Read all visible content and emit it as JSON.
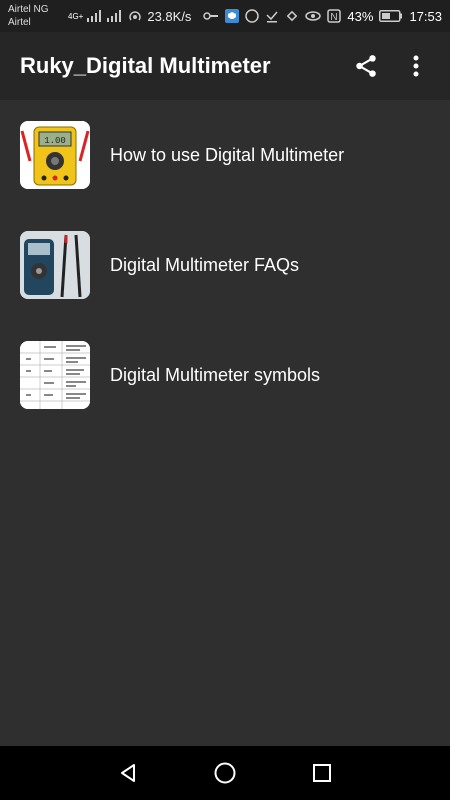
{
  "status_bar": {
    "carrier_1": "Airtel NG",
    "carrier_2": "Airtel",
    "network_type": "4G+",
    "speed": "23.8K/s",
    "battery": "43%",
    "time": "17:53"
  },
  "app_bar": {
    "title": "Ruky_Digital Multimeter",
    "share_icon": "share-icon",
    "menu_icon": "more-vert-icon"
  },
  "menu_items": [
    {
      "label": "How to use Digital Multimeter",
      "thumbnail": "yellow-multimeter"
    },
    {
      "label": "Digital Multimeter FAQs",
      "thumbnail": "multimeter-with-probes"
    },
    {
      "label": "Digital Multimeter symbols",
      "thumbnail": "symbols-table"
    }
  ],
  "nav_bar": {
    "back_icon": "back-triangle-icon",
    "home_icon": "home-circle-icon",
    "recents_icon": "recents-square-icon"
  },
  "colors": {
    "background": "#2f2f2f",
    "app_bar": "#262626",
    "status_bar": "#1f1f1f",
    "nav_bar": "#000000"
  }
}
